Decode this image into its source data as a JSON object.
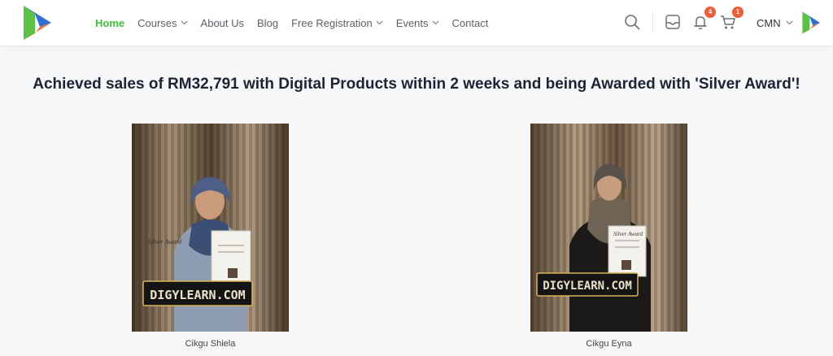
{
  "nav": {
    "items": [
      {
        "label": "Home",
        "active": true,
        "dropdown": false
      },
      {
        "label": "Courses",
        "active": false,
        "dropdown": true
      },
      {
        "label": "About Us",
        "active": false,
        "dropdown": false
      },
      {
        "label": "Blog",
        "active": false,
        "dropdown": false
      },
      {
        "label": "Free Registration",
        "active": false,
        "dropdown": true
      },
      {
        "label": "Events",
        "active": false,
        "dropdown": true
      },
      {
        "label": "Contact",
        "active": false,
        "dropdown": false
      }
    ],
    "active_color": "#3fc03a"
  },
  "tools": {
    "notifications_count": "4",
    "cart_count": "1",
    "user_name": "CMN"
  },
  "headline": "Achieved sales of RM32,791 with Digital Products within 2 weeks and being Awarded with 'Silver Award'!",
  "cards": [
    {
      "caption": "Cikgu Shiela",
      "plate": "DIGYLEARN.COM",
      "certificate": "Silver Award"
    },
    {
      "caption": "Cikgu Eyna",
      "plate": "DIGYLEARN.COM",
      "certificate": "Silver Award"
    }
  ],
  "brand_colors": {
    "green": "#5cc244",
    "orange": "#f26a2e",
    "blue": "#2f6fd6"
  }
}
